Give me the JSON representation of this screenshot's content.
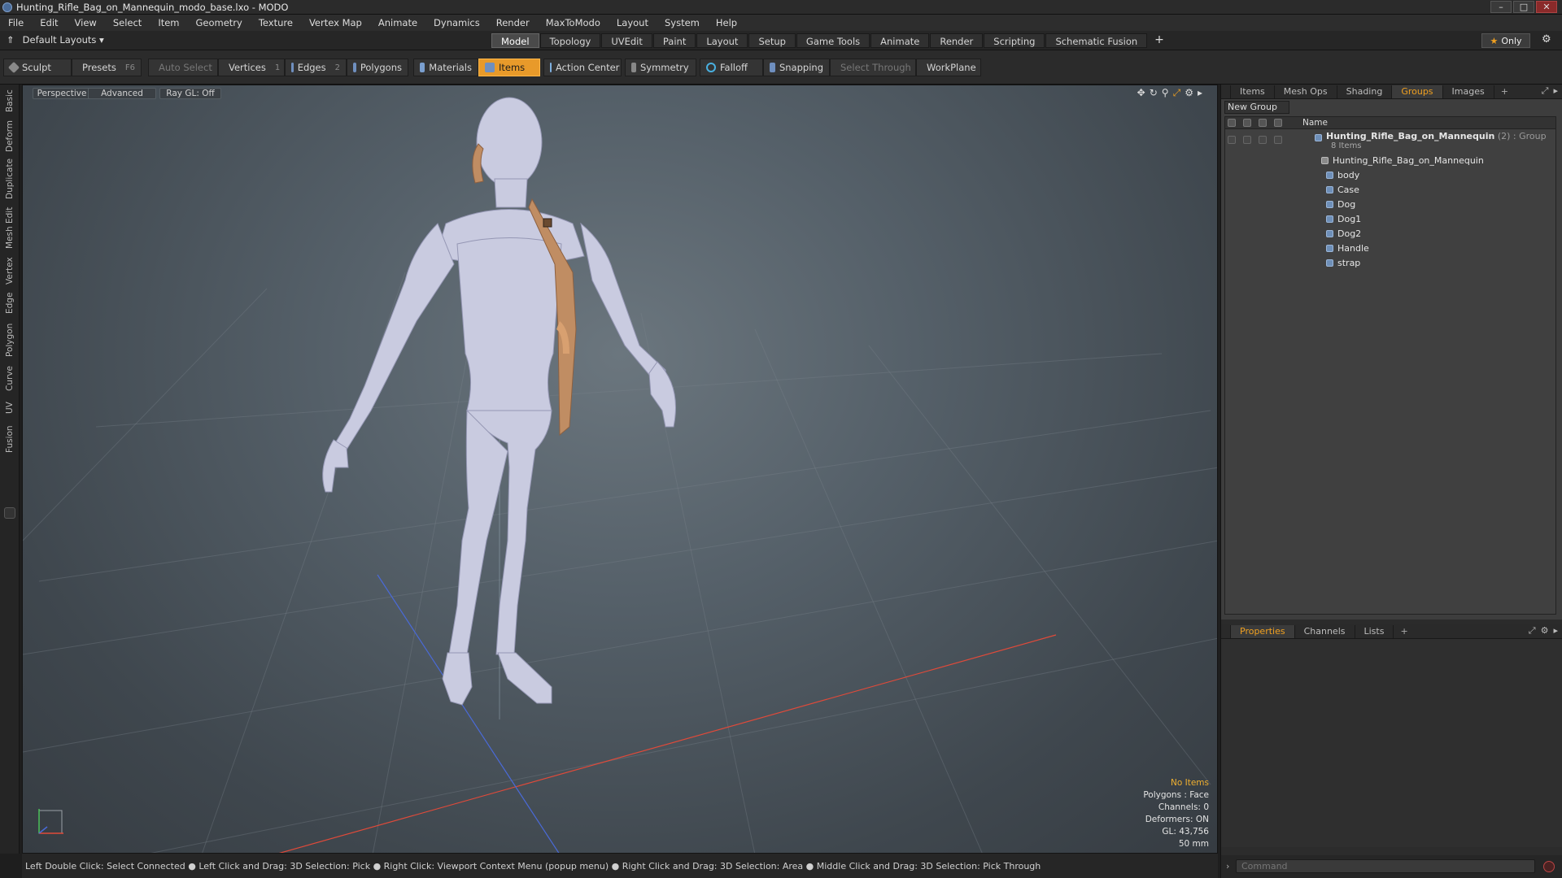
{
  "window": {
    "title": "Hunting_Rifle_Bag_on_Mannequin_modo_base.lxo - MODO",
    "controls": [
      "–",
      "□",
      "✕"
    ]
  },
  "menu": [
    "File",
    "Edit",
    "View",
    "Select",
    "Item",
    "Geometry",
    "Texture",
    "Vertex Map",
    "Animate",
    "Dynamics",
    "Render",
    "MaxToModo",
    "Layout",
    "System",
    "Help"
  ],
  "layout_selector": "Default Layouts ▾",
  "layout_tabs": [
    "Model",
    "Topology",
    "UVEdit",
    "Paint",
    "Layout",
    "Setup",
    "Game Tools",
    "Animate",
    "Render",
    "Scripting",
    "Schematic Fusion"
  ],
  "active_layout_tab": "Model",
  "only_button": "Only",
  "toolbar": {
    "sculpt": "Sculpt",
    "presets": "Presets",
    "presets_key": "F6",
    "auto_select": "Auto Select",
    "vertices": "Vertices",
    "vertices_key": "1",
    "edges": "Edges",
    "edges_key": "2",
    "polygons": "Polygons",
    "materials": "Materials",
    "items": "Items",
    "action_center": "Action Center",
    "symmetry": "Symmetry",
    "falloff": "Falloff",
    "snapping": "Snapping",
    "select_through": "Select Through",
    "workplane": "WorkPlane"
  },
  "left_tabs": [
    "Basic",
    "Deform",
    "Duplicate",
    "Mesh Edit",
    "Vertex",
    "Edge",
    "Polygon",
    "Curve",
    "UV",
    "Fusion"
  ],
  "viewport": {
    "view_mode": "Perspective",
    "shading": "Advanced",
    "raygl": "Ray GL: Off",
    "stats": {
      "selection": "No Items",
      "polygons": "Polygons : Face",
      "channels": "Channels: 0",
      "deformers": "Deformers: ON",
      "gl": "GL: 43,756",
      "scale": "50 mm"
    }
  },
  "status_bar": "Left Double Click: Select Connected ● Left Click and Drag: 3D Selection: Pick ● Right Click: Viewport Context Menu (popup menu) ● Right Click and Drag: 3D Selection: Area ● Middle Click and Drag: 3D Selection: Pick Through",
  "top_panel": {
    "tabs": [
      "Items",
      "Mesh Ops",
      "Shading",
      "Groups",
      "Images"
    ],
    "active_tab": "Groups",
    "new_group_button": "New Group",
    "column_name": "Name",
    "group": {
      "name": "Hunting_Rifle_Bag_on_Mannequin",
      "suffix": " (2) : Group",
      "count": "8 Items"
    },
    "children": [
      "Hunting_Rifle_Bag_on_Mannequin",
      "body",
      "Case",
      "Dog",
      "Dog1",
      "Dog2",
      "Handle",
      "strap"
    ]
  },
  "bottom_panel": {
    "tabs": [
      "Properties",
      "Channels",
      "Lists"
    ],
    "active_tab": "Properties",
    "command_placeholder": "Command"
  },
  "colors": {
    "accent": "#f0a020",
    "active_tool": "#e89a2a",
    "mesh": "#c9cbe0",
    "bag": "#c08d63",
    "axis_x": "#e04a3a",
    "axis_z": "#4a6ad8"
  }
}
